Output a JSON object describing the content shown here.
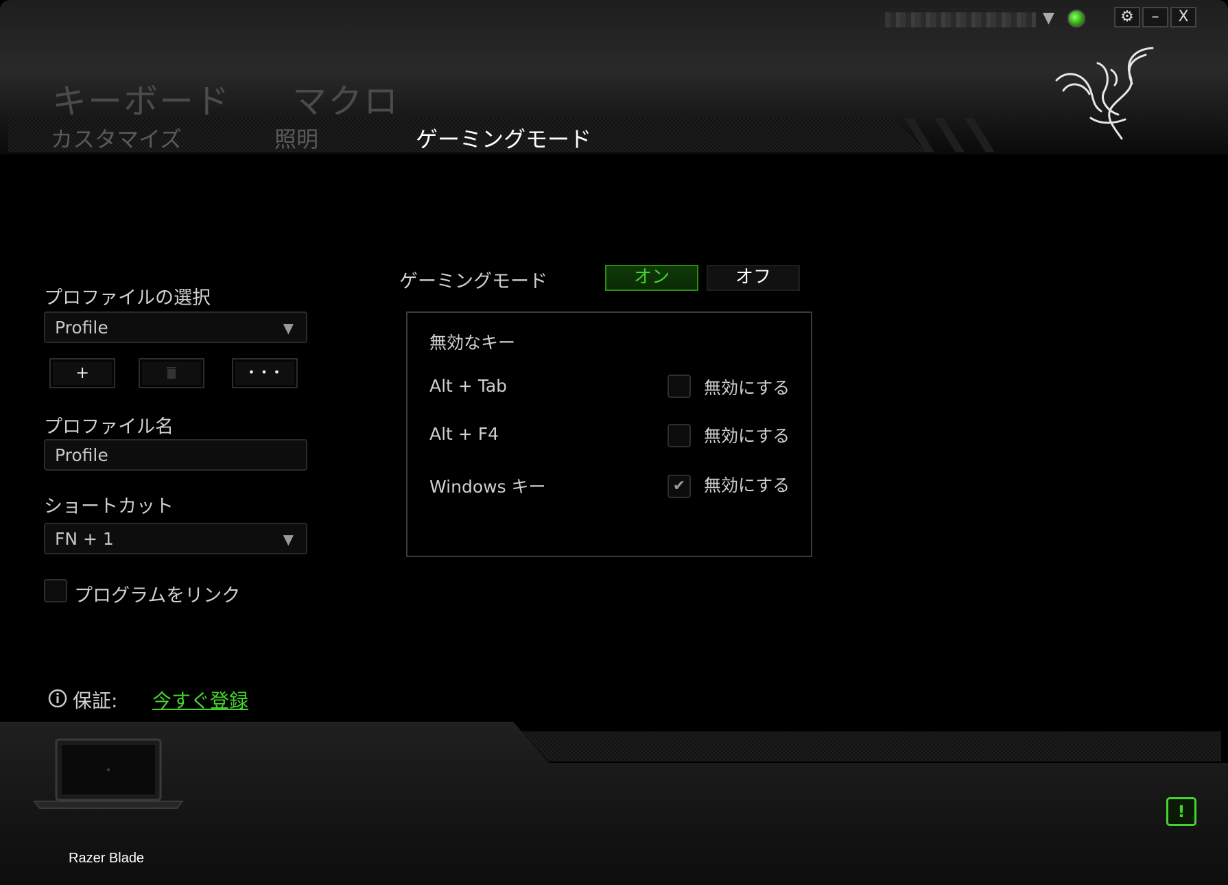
{
  "window": {
    "settings_icon": "gear-icon",
    "minimize_label": "–",
    "close_label": "X",
    "dropdown_glyph": "▼"
  },
  "nav": {
    "main_tabs": [
      "キーボード",
      "マクロ"
    ],
    "sub_tabs": [
      "カスタマイズ",
      "照明",
      "ゲーミングモード"
    ],
    "active_sub_tab": "ゲーミングモード"
  },
  "profile": {
    "select_label": "プロファイルの選択",
    "selected": "Profile",
    "add_label": "+",
    "delete_icon": "trash-icon",
    "more_label": "• • •",
    "name_label": "プロファイル名",
    "name_value": "Profile",
    "shortcut_label": "ショートカット",
    "shortcut_value": "FN + 1",
    "link_program_label": "プログラムをリンク",
    "link_program_checked": false
  },
  "gaming_mode": {
    "label": "ゲーミングモード",
    "on_label": "オン",
    "off_label": "オフ",
    "state": "on",
    "disabled_keys_title": "無効なキー",
    "disable_label": "無効にする",
    "keys": [
      {
        "name": "Alt + Tab",
        "checked": false
      },
      {
        "name": "Alt + F4",
        "checked": false
      },
      {
        "name": "Windows キー",
        "checked": true
      }
    ]
  },
  "warranty": {
    "label": "保証:",
    "link": "今すぐ登録"
  },
  "device": {
    "name": "Razer Blade"
  },
  "colors": {
    "accent": "#44d62c",
    "background": "#000000"
  }
}
